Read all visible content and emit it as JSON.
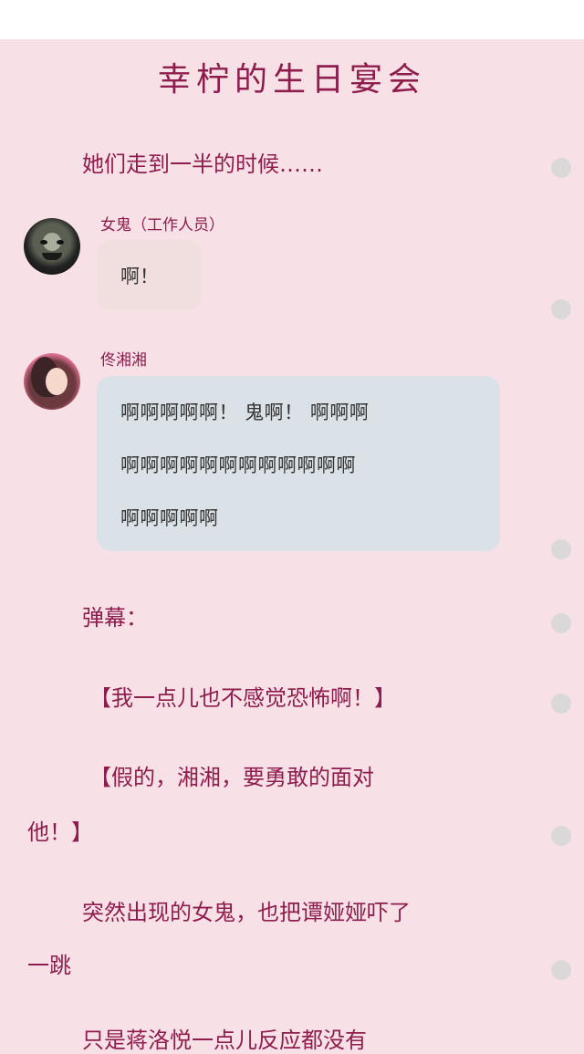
{
  "title": "幸柠的生日宴会",
  "narration": {
    "intro": "她们走到一半的时候……",
    "danmu_label": "弹幕：",
    "danmu_1": "【我一点儿也不感觉恐怖啊！】",
    "danmu_2_line1": "【假的，湘湘，要勇敢的面对",
    "danmu_2_line2": "他！】",
    "narration_2_line1": "突然出现的女鬼，也把谭娅娅吓了",
    "narration_2_line2": "一跳",
    "narration_3_partial": "只是蒋洛悦一点儿反应都没有"
  },
  "messages": [
    {
      "speaker": "女鬼（工作人员）",
      "avatar_icon": "ghost-avatar",
      "lines": [
        "啊！"
      ]
    },
    {
      "speaker": "佟湘湘",
      "avatar_icon": "girl-avatar",
      "lines": [
        "啊啊啊啊啊！ 鬼啊！ 啊啊啊",
        "啊啊啊啊啊啊啊啊啊啊啊啊",
        "啊啊啊啊啊"
      ]
    }
  ],
  "colors": {
    "background": "#f8e1e6",
    "title": "#8e1d4e",
    "ghost_bubble": "#f1dfe0",
    "girl_bubble": "#dae2e7"
  }
}
